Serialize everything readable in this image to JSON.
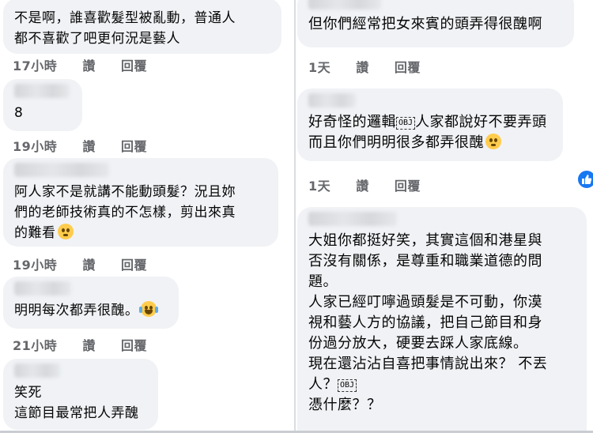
{
  "left": {
    "comments": [
      {
        "text": "不是啊，誰喜歡髮型被亂動，普通人\n都不喜歡了吧更何況是藝人",
        "time": "17小時",
        "like": "讚",
        "reply": "回覆"
      },
      {
        "text": "8",
        "time": "19小時",
        "like": "讚",
        "reply": "回覆"
      },
      {
        "text": "阿人家不是就講不能動頭髮？況且妳\n們的老師技術真的不怎樣，剪出來真\n的難看",
        "emoji": "flushed-face",
        "time": "19小時",
        "like": "讚",
        "reply": "回覆"
      },
      {
        "text": "明明每次都弄很醜。",
        "emoji": "tears-of-joy-face",
        "time": "21小時",
        "like": "讚",
        "reply": "回覆"
      },
      {
        "text": "笑死\n這節目最常把人弄醜"
      }
    ]
  },
  "right": {
    "comments": [
      {
        "text": "但你們經常把女來賓的頭弄得很醜啊",
        "time": "1天",
        "like": "讚",
        "reply": "回覆"
      },
      {
        "line1_a": "好奇怪的邏輯",
        "obj": "OBJ",
        "line1_b": "人家都說好不要弄頭",
        "line2": "而且你們明明很多都弄很醜",
        "emoji": "flushed-face",
        "time": "1天",
        "like": "讚",
        "reply": "回覆"
      },
      {
        "para1": "大姐你都挺好笑，其實這個和港星與\n否沒有關係，是尊重和職業道德的問\n題。",
        "para2": "人家已經叮嚀過頭髮是不可動，你漠\n視和藝人方的協議，把自己節目和身\n份過分放大，硬要去踩人家底線。",
        "para3a": "現在還沾沾自喜把事情說出來？ 不丟\n人？",
        "obj": "OBJ",
        "para4": "憑什麼？？"
      }
    ]
  },
  "colors": {
    "bubble": "#f0f2f5",
    "meta": "#65676b",
    "text": "#050505",
    "like_badge": "#1877f2"
  }
}
